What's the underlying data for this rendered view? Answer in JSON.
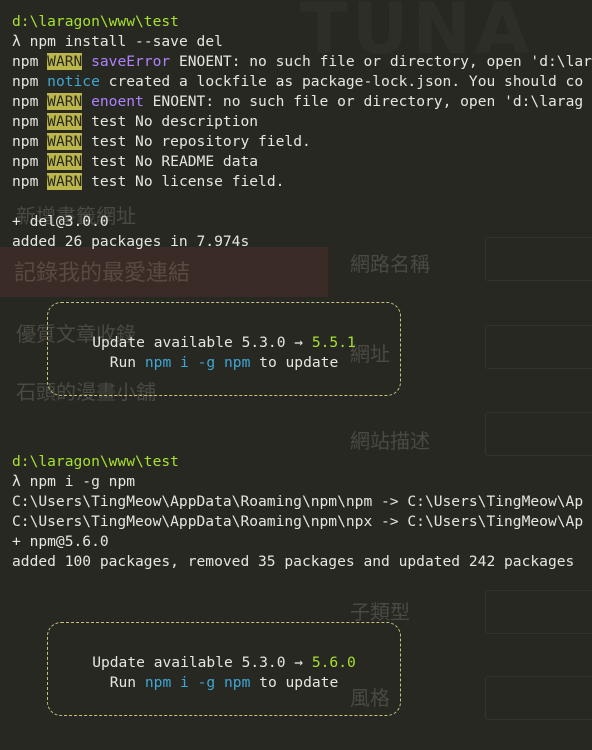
{
  "prompt1": {
    "path": "d:\\laragon\\www\\test",
    "lambda": "λ",
    "command": "npm install --save del"
  },
  "install_log": [
    {
      "prefix": "npm",
      "level": "WARN",
      "tag": "saveError",
      "msg": "ENOENT: no such file or directory, open 'd:\\lar"
    },
    {
      "prefix": "npm",
      "level": "notice",
      "tag": "",
      "msg": "created a lockfile as package-lock.json. You should co"
    },
    {
      "prefix": "npm",
      "level": "WARN",
      "tag": "enoent",
      "msg": "ENOENT: no such file or directory, open 'd:\\larag"
    },
    {
      "prefix": "npm",
      "level": "WARN",
      "tag": "",
      "msg": "test No description"
    },
    {
      "prefix": "npm",
      "level": "WARN",
      "tag": "",
      "msg": "test No repository field."
    },
    {
      "prefix": "npm",
      "level": "WARN",
      "tag": "",
      "msg": "test No README data"
    },
    {
      "prefix": "npm",
      "level": "WARN",
      "tag": "",
      "msg": "test No license field."
    }
  ],
  "install_result": [
    "+ del@3.0.0",
    "added 26 packages in 7.974s"
  ],
  "update_box1": {
    "text": "Update available 5.3.0 → ",
    "version": "5.5.1",
    "run": "Run ",
    "cmd1": "npm",
    "cmd2": "i",
    "cmd3": "-g",
    "cmd4": "npm",
    "tail": " to update"
  },
  "prompt2": {
    "path": "d:\\laragon\\www\\test",
    "lambda": "λ",
    "command": "npm i -g npm"
  },
  "npm_update_log": [
    "C:\\Users\\TingMeow\\AppData\\Roaming\\npm\\npm -> C:\\Users\\TingMeow\\Ap",
    "C:\\Users\\TingMeow\\AppData\\Roaming\\npm\\npx -> C:\\Users\\TingMeow\\Ap",
    "+ npm@5.6.0",
    "added 100 packages, removed 35 packages and updated 242 packages"
  ],
  "update_box2": {
    "text": "Update available 5.3.0 → ",
    "version": "5.6.0",
    "run": "Run ",
    "cmd1": "npm",
    "cmd2": "i",
    "cmd3": "-g",
    "cmd4": "npm",
    "tail": " to update"
  },
  "ghost": {
    "logo": "TUNA",
    "left_labels": [
      "新增書籤網址",
      "記錄我的最愛連結",
      "優質文章收錄",
      "石頭的漫畫小舖"
    ],
    "right_labels": [
      "網路名稱",
      "網址",
      "網站描述",
      "子類型",
      "風格"
    ]
  }
}
